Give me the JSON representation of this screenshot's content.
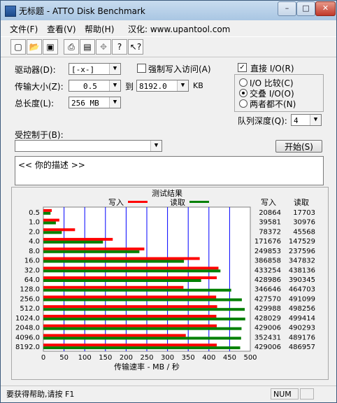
{
  "window": {
    "title": "无标题 - ATTO Disk Benchmark",
    "minimize": "–",
    "maximize": "□",
    "close": "✕"
  },
  "menu": [
    "文件(F)",
    "查看(V)",
    "帮助(H)",
    "汉化: www.upantool.com"
  ],
  "toolbar": {
    "buttons": [
      "new-icon",
      "open-icon",
      "save-icon",
      "print-icon",
      "print-preview-icon",
      "move-icon",
      "help-icon",
      "context-help-icon"
    ]
  },
  "settings": {
    "drive_label": "驱动器(D):",
    "drive_value": "[-x-]",
    "force_write_label": "强制写入访问(A)",
    "transfer_size_label": "传输大小(Z):",
    "transfer_from": "0.5",
    "transfer_to_label": "到",
    "transfer_to": "8192.0",
    "transfer_unit": "KB",
    "total_length_label": "总长度(L):",
    "total_length": "256 MB",
    "direct_io_label": "直接 I/O(R)",
    "direct_io_checked": "✓",
    "io_compare_label": "I/O 比较(C)",
    "overlapped_io_label": "交叠 I/O(O)",
    "neither_label": "两者都不(N)",
    "queue_depth_label": "队列深度(Q):",
    "queue_depth": "4",
    "controlled_by_label": "受控制于(B):",
    "controlled_by": "",
    "start_button": "开始(S)",
    "description": "<<  你的描述  >>"
  },
  "chart_data": {
    "type": "bar",
    "title": "测试结果",
    "orientation": "horizontal",
    "categories": [
      "0.5",
      "1.0",
      "2.0",
      "4.0",
      "8.0",
      "16.0",
      "32.0",
      "64.0",
      "128.0",
      "256.0",
      "512.0",
      "1024.0",
      "2048.0",
      "4096.0",
      "8192.0"
    ],
    "series": [
      {
        "name": "写入",
        "color": "#ff0000",
        "values": [
          20864,
          39581,
          78372,
          171676,
          249853,
          386858,
          433254,
          428986,
          346646,
          427570,
          429988,
          428029,
          429006,
          352431,
          429006
        ]
      },
      {
        "name": "读取",
        "color": "#008000",
        "values": [
          17703,
          30976,
          45568,
          147529,
          237596,
          347832,
          438136,
          390345,
          464703,
          491099,
          498256,
          499414,
          490293,
          489176,
          486957
        ]
      }
    ],
    "xlabel": "传输速率 - MB / 秒",
    "xlim": [
      0,
      500
    ],
    "xticks": [
      0,
      50,
      100,
      150,
      200,
      250,
      300,
      350,
      400,
      450,
      500
    ],
    "legend_position": "top",
    "columns": [
      "写入",
      "读取"
    ],
    "grid": true
  },
  "status": {
    "help_text": "要获得帮助,请按 F1",
    "num": "NUM"
  },
  "colors": {
    "write": "#ff0000",
    "read": "#008000",
    "grid": "#0000ff",
    "plot_bg": "#ffffff"
  }
}
